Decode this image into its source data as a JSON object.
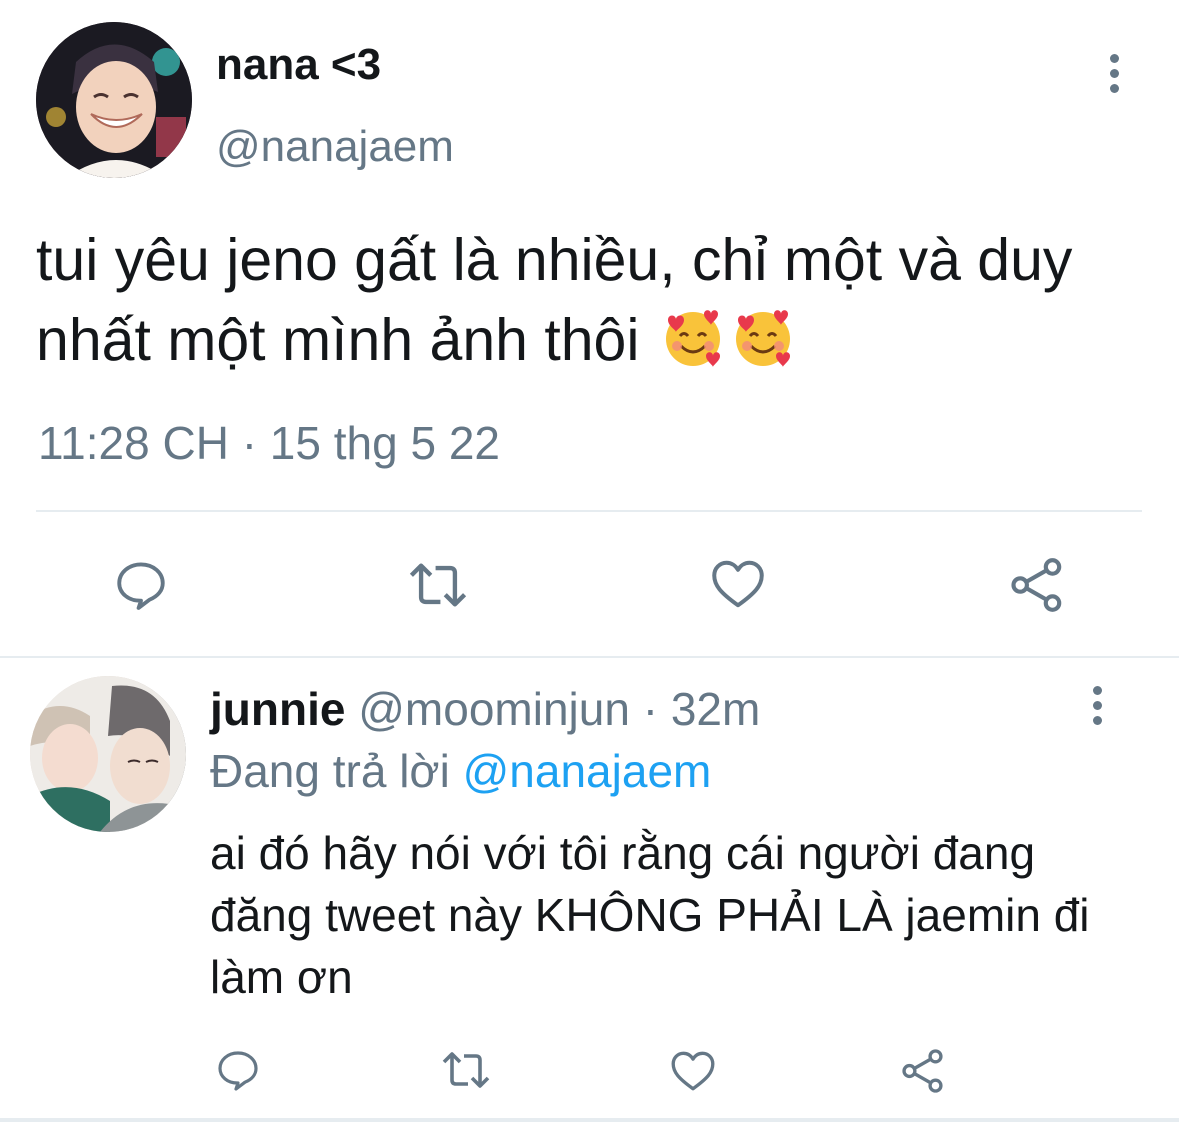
{
  "main_tweet": {
    "author": {
      "display_name": "nana <3",
      "handle": "@nanajaem"
    },
    "text": "tui yêu jeno gất là nhiều, chỉ một và duy nhất một mình ảnh thôi",
    "emojis": [
      "smiling-face-with-hearts",
      "smiling-face-with-hearts"
    ],
    "timestamp": "11:28 CH · 15 thg 5 22",
    "actions": [
      "reply-icon",
      "retweet-icon",
      "like-icon",
      "share-icon"
    ]
  },
  "reply_tweet": {
    "author": {
      "display_name": "junnie",
      "handle": "@moominjun"
    },
    "separator": "·",
    "time": "32m",
    "replying_label": "Đang trả lời",
    "replying_to": "@nanajaem",
    "text": "ai đó hãy nói với tôi rằng cái người đang đăng tweet này KHÔNG PHẢI LÀ jaemin đi làm ơn",
    "actions": [
      "reply-icon",
      "retweet-icon",
      "like-icon",
      "share-icon"
    ]
  },
  "colors": {
    "text": "#14171a",
    "secondary": "#657786",
    "link": "#1da1f2",
    "divider": "#e6ecf0"
  }
}
